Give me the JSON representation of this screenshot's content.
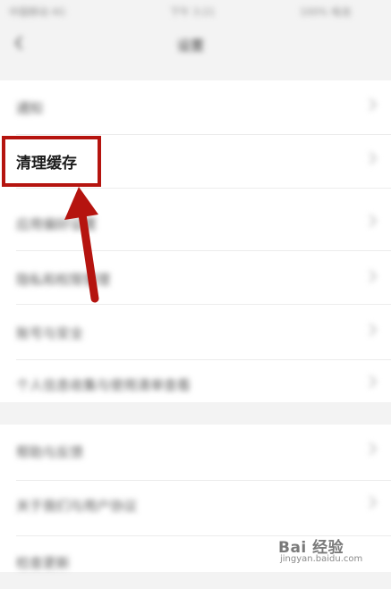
{
  "status_bar": {
    "left": "中国移动 4G",
    "center": "下午 3:21",
    "right": "100% 电池"
  },
  "nav": {
    "title": "设置"
  },
  "settings": {
    "group1": [
      {
        "label": "通知"
      },
      {
        "label": "清理缓存"
      },
      {
        "label": "应用偏好设置"
      },
      {
        "label": "隐私和权限管理"
      },
      {
        "label": "账号与安全"
      },
      {
        "label": "个人信息收集与使用清单查看"
      }
    ],
    "group2": [
      {
        "label": "帮助与反馈"
      },
      {
        "label": "关于我们与用户协议"
      },
      {
        "label": "检查更新"
      }
    ]
  },
  "highlight": {
    "label": "清理缓存",
    "color": "#b5140f"
  },
  "watermark": {
    "logo": "Bai 经验",
    "url": "jingyan.baidu.com"
  }
}
